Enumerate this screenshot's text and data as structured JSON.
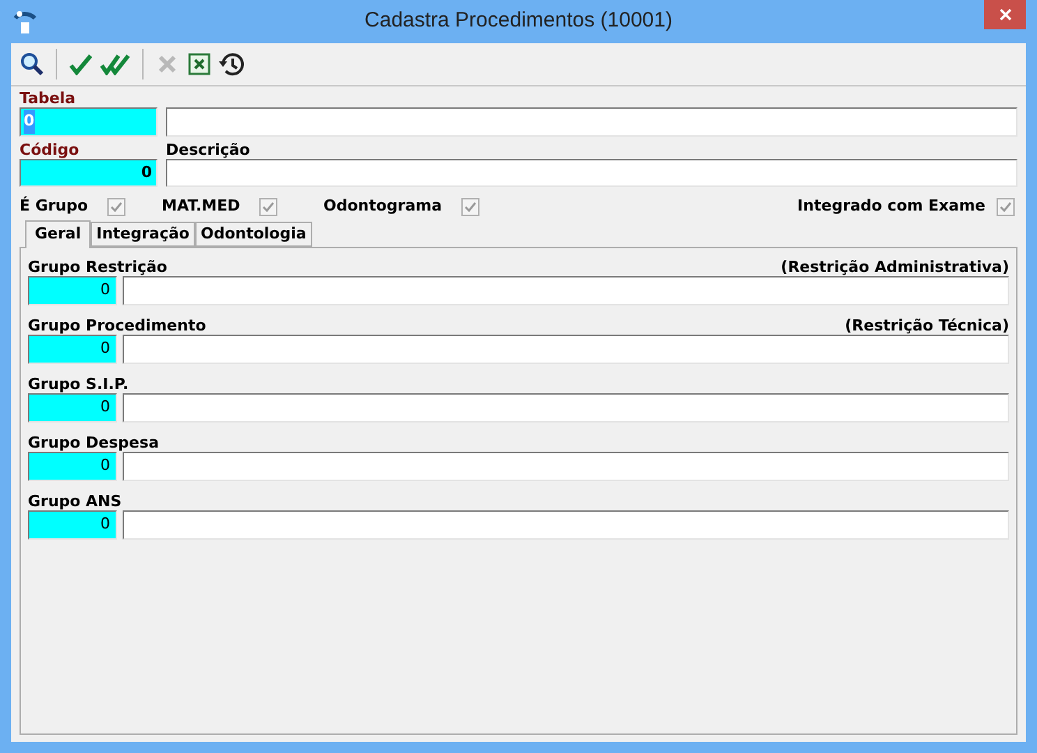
{
  "window": {
    "title": "Cadastra Procedimentos (10001)"
  },
  "toolbar": [
    {
      "kind": "search",
      "disabled": false
    },
    {
      "kind": "separator"
    },
    {
      "kind": "check",
      "disabled": false
    },
    {
      "kind": "double-check",
      "disabled": false
    },
    {
      "kind": "separator"
    },
    {
      "kind": "cancel",
      "disabled": true
    },
    {
      "kind": "excel",
      "disabled": false
    },
    {
      "kind": "history",
      "disabled": false
    }
  ],
  "tabela": {
    "label": "Tabela",
    "code": "0",
    "code_highlighted": true
  },
  "codigo": {
    "label": "Código",
    "code": "0"
  },
  "descricao": {
    "label": "Descrição"
  },
  "checkboxes": [
    {
      "label": "É Grupo",
      "checked": true,
      "disabled": true
    },
    {
      "label": "MAT.MED",
      "checked": true,
      "disabled": true
    },
    {
      "label": "Odontograma",
      "checked": true,
      "disabled": true
    },
    {
      "label": "Integrado com Exame",
      "checked": true,
      "disabled": true
    }
  ],
  "tabs": [
    {
      "label": "Geral",
      "selected": true
    },
    {
      "label": "Integração",
      "selected": false
    },
    {
      "label": "Odontologia",
      "selected": false
    }
  ],
  "groups": [
    {
      "label": "Grupo Restrição",
      "note": "(Restrição Administrativa)",
      "code": "0"
    },
    {
      "label": "Grupo Procedimento",
      "note": "(Restrição Técnica)",
      "code": "0"
    },
    {
      "label": "Grupo S.I.P.",
      "code": "0"
    },
    {
      "label": "Grupo Despesa",
      "code": "0"
    },
    {
      "label": "Grupo ANS",
      "code": "0"
    }
  ]
}
